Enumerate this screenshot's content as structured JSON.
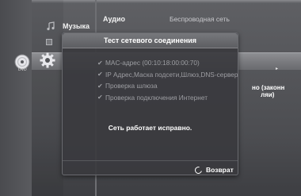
{
  "menu": {
    "music_label": "Музыка",
    "audio_label": "Аудио",
    "wireless_label": "Беспроводная сеть",
    "dvd_label": "DVD",
    "side_value": "но (законн\n     ляи)"
  },
  "dialog": {
    "title": "Тест сетевого соединения",
    "items": [
      {
        "label": "MAC-адрес (00:10:18:00:00:70)"
      },
      {
        "label": "IP Адрес,Маска подсети,Шлюз,DNS-сервер"
      },
      {
        "label": "Проверка шлюза"
      },
      {
        "label": "Проверка подключения Интернет"
      }
    ],
    "check_mark": "✔",
    "result": "Сеть работает исправно.",
    "return_label": "Возврат"
  },
  "colors": {
    "background": "#55565a",
    "dialog": "#3a3a3e",
    "check_text": "#9d9ea2"
  }
}
